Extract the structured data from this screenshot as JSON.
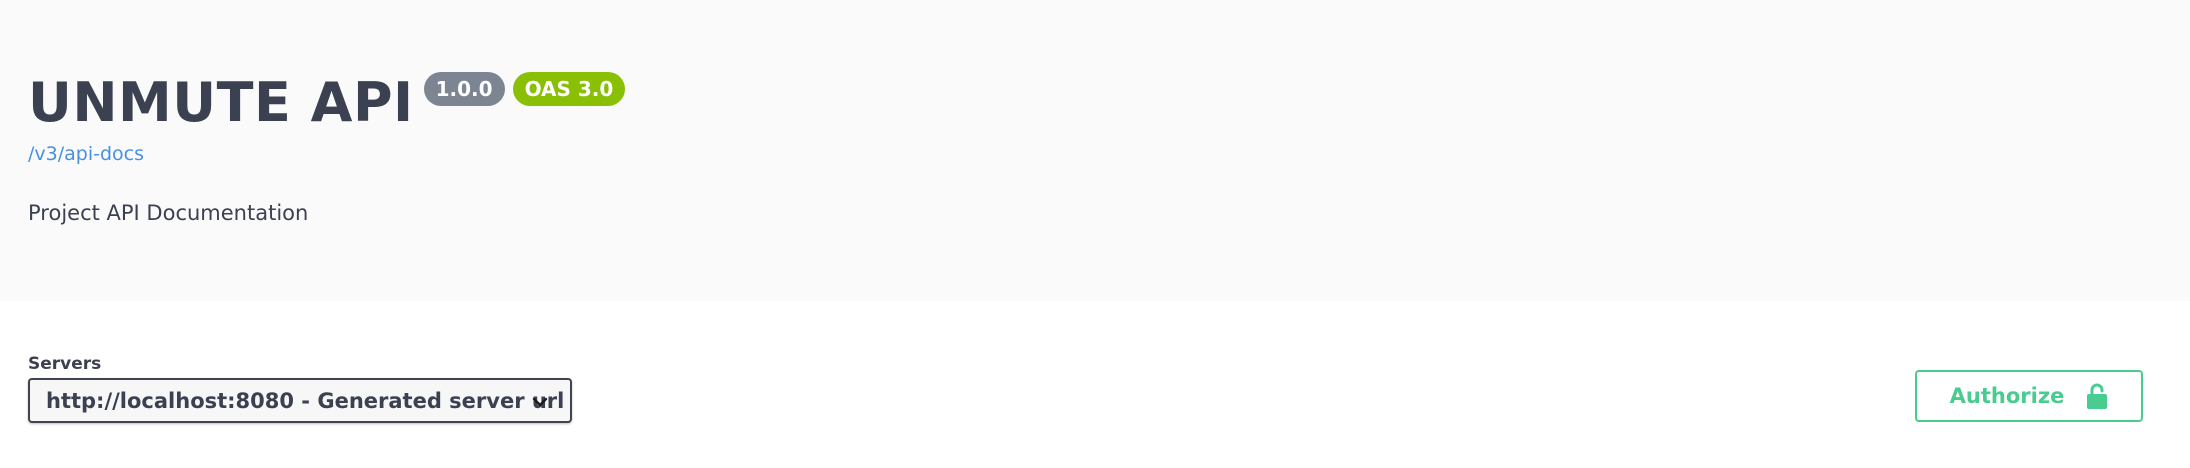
{
  "info": {
    "title": "UNMUTE API",
    "version_badge": "1.0.0",
    "oas_badge": "OAS 3.0",
    "docs_link": "/v3/api-docs",
    "description": "Project API Documentation"
  },
  "servers": {
    "label": "Servers",
    "selected": "http://localhost:8080 - Generated server url"
  },
  "authorize": {
    "label": "Authorize"
  },
  "icons": {
    "dropdown": "chevron-down-icon",
    "authorize": "unlocked-padlock-icon"
  },
  "colors": {
    "info_background": "#fafafa",
    "title_text": "#3b4151",
    "version_badge": "#7d8492",
    "oas_badge": "#89bf04",
    "link": "#4990e2",
    "authorize_accent": "#49cc90",
    "select_border": "#41444e"
  }
}
